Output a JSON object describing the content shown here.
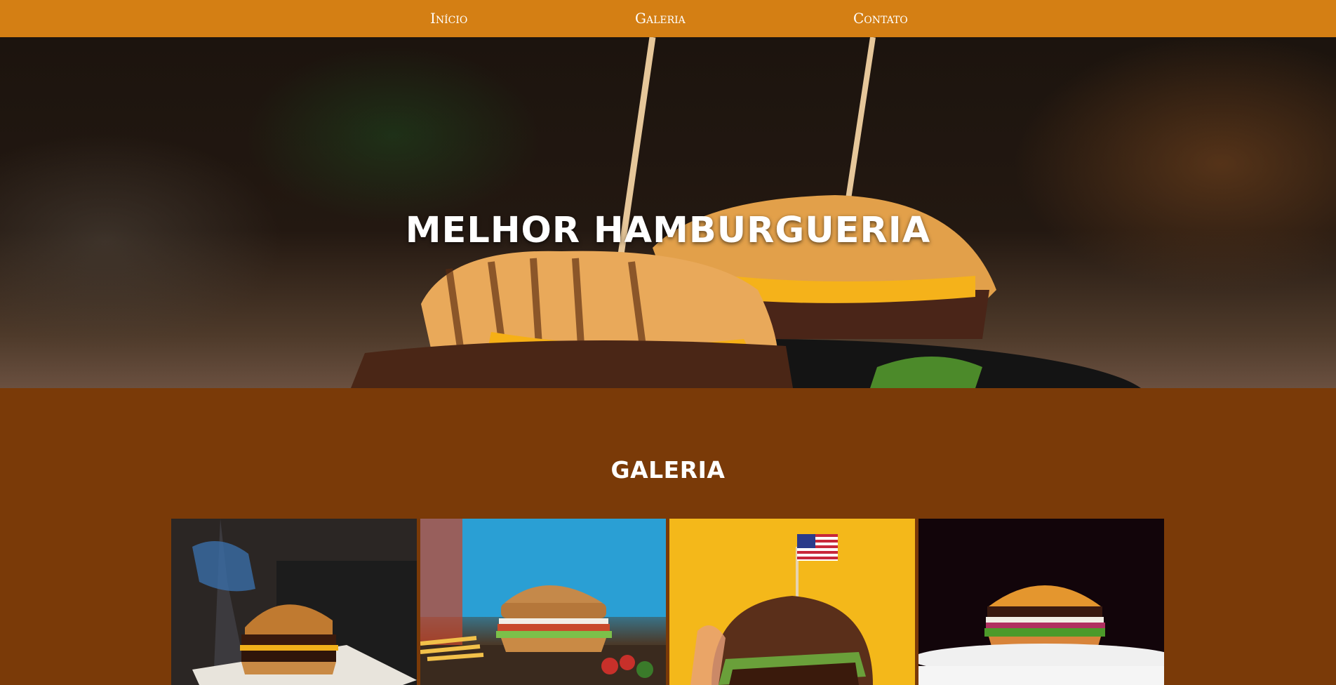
{
  "nav": {
    "items": [
      {
        "label": "Início"
      },
      {
        "label": "Galeria"
      },
      {
        "label": "Contato"
      }
    ]
  },
  "hero": {
    "title": "MELHOR HAMBURGUERIA"
  },
  "gallery": {
    "title": "GALERIA",
    "photos": [
      {
        "icon": "burger-photo-grill"
      },
      {
        "icon": "burger-photo-fries"
      },
      {
        "icon": "burger-photo-flag"
      },
      {
        "icon": "burger-photo-plate"
      }
    ]
  },
  "colors": {
    "nav_bg": "#d47f14",
    "section_bg": "#7a3a08",
    "text": "#ffffff"
  }
}
